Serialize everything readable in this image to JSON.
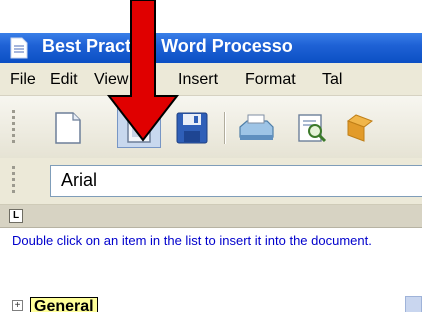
{
  "titlebar": {
    "title": "Best Practice Word Processo"
  },
  "menubar": {
    "items": [
      "File",
      "Edit",
      "View",
      "Insert",
      "Format",
      "Tal"
    ]
  },
  "toolbar": {
    "buttons": [
      "new-document",
      "open-document",
      "save",
      "print",
      "print-preview",
      "other"
    ]
  },
  "fontbar": {
    "font_name": "Arial"
  },
  "ruler": {
    "tab_marker": "L"
  },
  "help": {
    "text": "Double click on an item in the list to insert it into the document."
  },
  "tree": {
    "expander": "+",
    "first_item": "General"
  },
  "colors": {
    "titlebar": "#1f62d6",
    "help_text": "#0000cc",
    "arrow": "#e00000",
    "selected_item": "#ffff99"
  }
}
